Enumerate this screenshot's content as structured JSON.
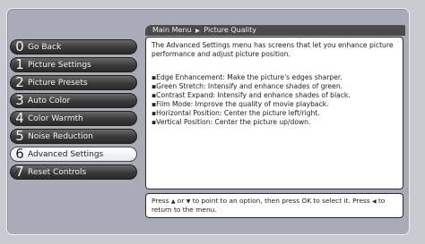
{
  "breadcrumb": {
    "parent": "Main Menu",
    "separator": "▶",
    "current": "Picture Quality"
  },
  "menu": [
    {
      "number": "0",
      "label": "Go Back",
      "selected": false
    },
    {
      "number": "1",
      "label": "Picture Settings",
      "selected": false
    },
    {
      "number": "2",
      "label": "Picture Presets",
      "selected": false
    },
    {
      "number": "3",
      "label": "Auto Color",
      "selected": false
    },
    {
      "number": "4",
      "label": "Color Warmth",
      "selected": false
    },
    {
      "number": "5",
      "label": "Noise Reduction",
      "selected": false
    },
    {
      "number": "6",
      "label": "Advanced Settings",
      "selected": true
    },
    {
      "number": "7",
      "label": "Reset Controls",
      "selected": false
    }
  ],
  "content": {
    "intro": "The Advanced Settings menu has screens that let you enhance picture performance and adjust picture position.",
    "bullets": [
      "Edge Enhancement: Make the picture's edges sharper.",
      "Green Stretch: Intensify and enhance shades of green.",
      "Contrast Expand: Intensify and enhance shades of black.",
      "Film Mode: Improve the quality of movie playback.",
      "Horizontal Position: Center the picture left/right.",
      "Vertical Position: Center the picture up/down."
    ],
    "bullet_marker": "▪"
  },
  "footer": {
    "part1": "Press",
    "up_arrow": "▲",
    "or": "or",
    "down_arrow": "▼",
    "part2": "to point to an option, then press OK to select it. Press",
    "left_arrow": "◀",
    "part3": "to return to the menu."
  },
  "colors": {
    "background": "#c9cbd2",
    "panel": "#a9acb7",
    "menu_item": "#3a3a3a",
    "menu_selected": "#ffffff",
    "header_bar": "#4a4a4a"
  }
}
